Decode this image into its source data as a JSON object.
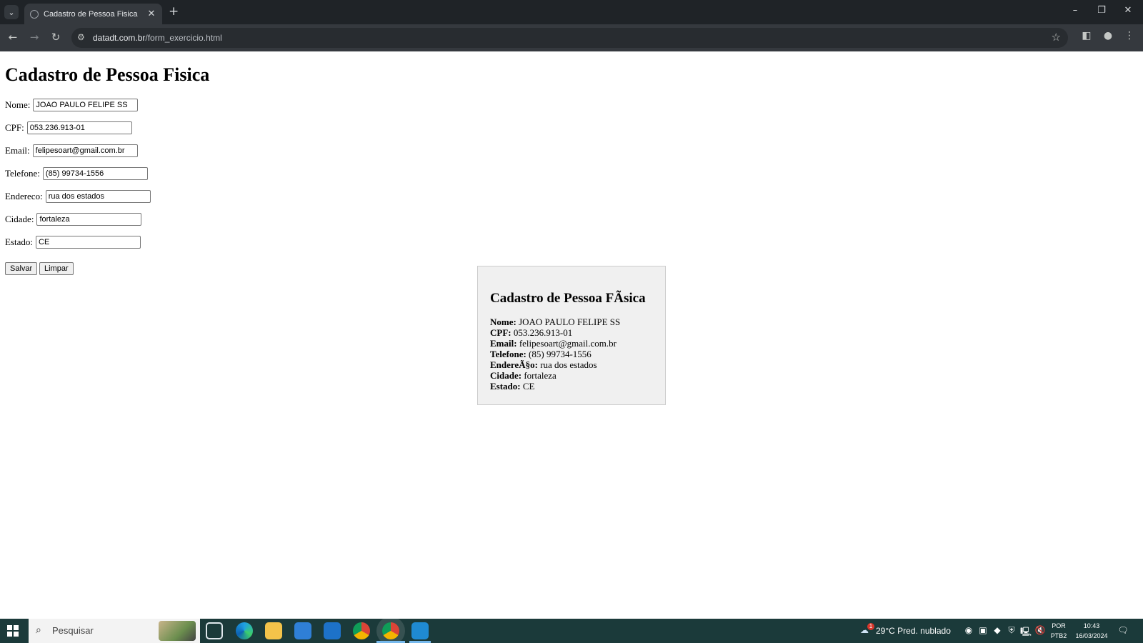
{
  "browser": {
    "tab_title": "Cadastro de Pessoa Fisica",
    "url_domain": "datadt.com.br",
    "url_path": "/form_exercicio.html",
    "icons": {
      "tab_search": "chevron-down-icon",
      "tab_close": "close-icon",
      "new_tab": "plus-icon",
      "back": "back-arrow-icon",
      "forward": "forward-arrow-icon",
      "reload": "reload-icon",
      "site_info": "tune-icon",
      "bookmark": "star-icon",
      "side_panel": "side-panel-icon",
      "profile": "profile-icon",
      "menu": "more-vert-icon"
    }
  },
  "form": {
    "heading": "Cadastro de Pessoa Fisica",
    "fields": [
      {
        "label": "Nome:",
        "value": "JOAO PAULO FELIPE SS"
      },
      {
        "label": "CPF:",
        "value": "053.236.913-01"
      },
      {
        "label": "Email:",
        "value": "felipesoart@gmail.com.br"
      },
      {
        "label": "Telefone:",
        "value": "(85) 99734-1556"
      },
      {
        "label": "Endereco:",
        "value": "rua dos estados"
      },
      {
        "label": "Cidade:",
        "value": "fortaleza"
      },
      {
        "label": "Estado:",
        "value": "CE"
      }
    ],
    "save_label": "Salvar",
    "clear_label": "Limpar"
  },
  "result": {
    "heading": "Cadastro de Pessoa FÃsica",
    "lines": [
      {
        "label": "Nome:",
        "value": "JOAO PAULO FELIPE SS"
      },
      {
        "label": "CPF:",
        "value": "053.236.913-01"
      },
      {
        "label": "Email:",
        "value": "felipesoart@gmail.com.br"
      },
      {
        "label": "Telefone:",
        "value": "(85) 99734-1556"
      },
      {
        "label": "EndereÃ§o:",
        "value": "rua dos estados"
      },
      {
        "label": "Cidade:",
        "value": "fortaleza"
      },
      {
        "label": "Estado:",
        "value": "CE"
      }
    ]
  },
  "taskbar": {
    "search_placeholder": "Pesquisar",
    "weather": "29°C  Pred. nublado",
    "language": "POR",
    "layout": "PTB2",
    "time": "10:43",
    "date": "16/03/2024",
    "weather_badge": "1",
    "apps": [
      "task-view-icon",
      "edge-icon",
      "file-explorer-icon",
      "store-icon",
      "mail-icon",
      "chrome-icon",
      "chrome-active-icon",
      "vscode-icon"
    ]
  },
  "colors": {
    "chrome_dark": "#1f2327",
    "chrome_toolbar": "#35393e",
    "taskbar": "#1b3a3a",
    "result_bg": "#f0f0f0"
  }
}
